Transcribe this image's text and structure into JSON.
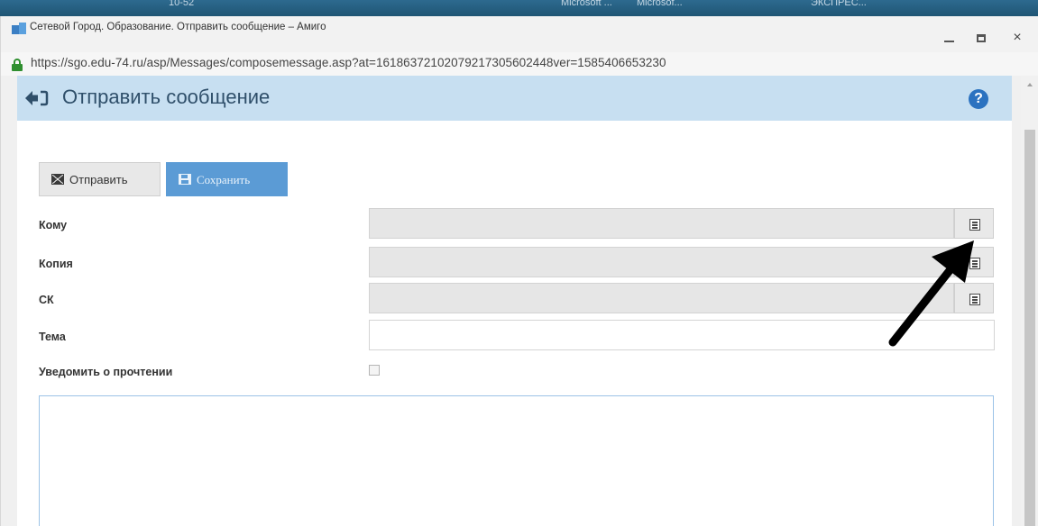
{
  "taskbar": {
    "items": [
      "10-52",
      "Microsoft ...",
      "Microsof...",
      "ЭКСПРЕС..."
    ]
  },
  "window": {
    "title": "Сетевой Город. Образование. Отправить сообщение – Амиго",
    "url": "https://sgo.edu-74.ru/asp/Messages/composemessage.asp?at=16186372102079217305602448ver=1585406653230",
    "controls": {
      "minimize": "–",
      "maximize": "□",
      "close": "×"
    }
  },
  "header": {
    "title": "Отправить сообщение",
    "help": "?"
  },
  "toolbar": {
    "send_label": "Отправить",
    "save_label": "Сохранить"
  },
  "form": {
    "to_label": "Кому",
    "copy_label": "Копия",
    "bcc_label": "СК",
    "subject_label": "Тема",
    "read_receipt_label": "Уведомить о прочтении",
    "read_receipt_checked": false,
    "to_value": "",
    "copy_value": "",
    "bcc_value": "",
    "subject_value": "",
    "body_value": ""
  },
  "colors": {
    "header_bg": "#c7dff1",
    "save_button": "#5b9bd5",
    "help_icon": "#2b72c0",
    "annotation_arrow": "#000000"
  },
  "icons": [
    "app-icon",
    "lock-icon",
    "back-icon",
    "help-icon",
    "envelope-icon",
    "save-icon",
    "address-book-icon",
    "annotation-arrow"
  ]
}
